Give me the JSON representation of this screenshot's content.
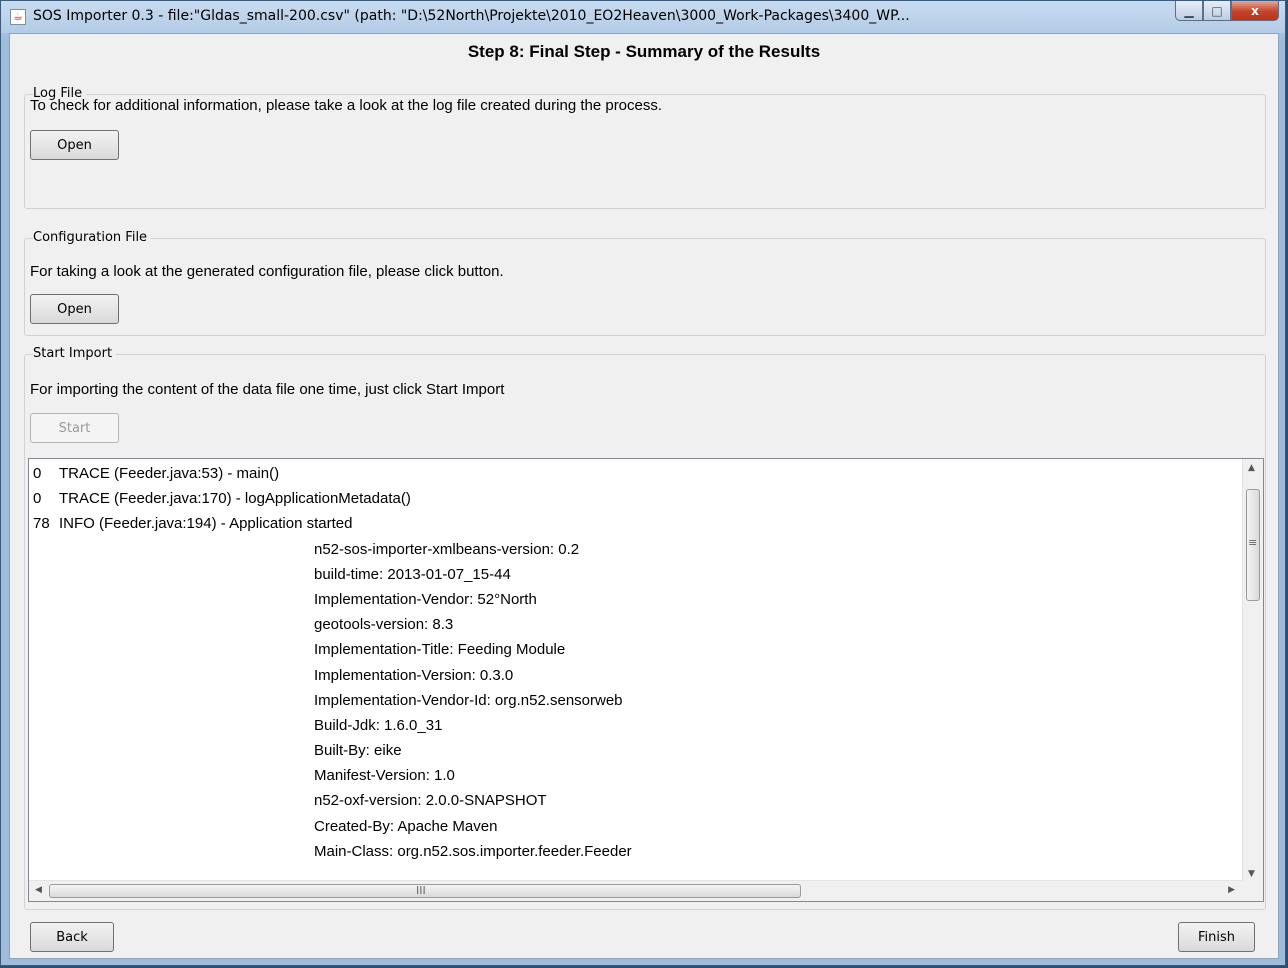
{
  "window": {
    "title": "SOS Importer 0.3 - file:\"Gldas_small-200.csv\" (path: \"D:\\52North\\Projekte\\2010_EO2Heaven\\3000_Work-Packages\\3400_WP...",
    "icon": "java-icon",
    "controls": {
      "minimize": "minimize-icon",
      "maximize": "maximize-icon",
      "close": "x"
    }
  },
  "step_title": "Step 8: Final Step - Summary of the Results",
  "log_file": {
    "label": "Log File",
    "description": "To check for additional information, please take a look at the log file created during the process.",
    "button": "Open"
  },
  "config_file": {
    "label": "Configuration File",
    "description": "For taking a look at the generated configuration file, please click button.",
    "button": "Open"
  },
  "start_import": {
    "label": "Start Import",
    "description": "For importing the content of the data file one time, just click Start Import",
    "button": "Start"
  },
  "log_lines": [
    {
      "time": "0",
      "text": "TRACE (Feeder.java:53) - main()"
    },
    {
      "time": "0",
      "text": "TRACE (Feeder.java:170) - logApplicationMetadata()"
    },
    {
      "time": "78",
      "text": " INFO (Feeder.java:194) - Application started"
    },
    {
      "time": "",
      "text": "n52-sos-importer-xmlbeans-version: 0.2"
    },
    {
      "time": "",
      "text": "build-time: 2013-01-07_15-44"
    },
    {
      "time": "",
      "text": "Implementation-Vendor: 52°North"
    },
    {
      "time": "",
      "text": "geotools-version: 8.3"
    },
    {
      "time": "",
      "text": "Implementation-Title: Feeding Module"
    },
    {
      "time": "",
      "text": "Implementation-Version: 0.3.0"
    },
    {
      "time": "",
      "text": "Implementation-Vendor-Id: org.n52.sensorweb"
    },
    {
      "time": "",
      "text": "Build-Jdk: 1.6.0_31"
    },
    {
      "time": "",
      "text": "Built-By: eike"
    },
    {
      "time": "",
      "text": "Manifest-Version: 1.0"
    },
    {
      "time": "",
      "text": "n52-oxf-version: 2.0.0-SNAPSHOT"
    },
    {
      "time": "",
      "text": "Created-By: Apache Maven"
    },
    {
      "time": "",
      "text": "Main-Class: org.n52.sos.importer.feeder.Feeder"
    }
  ],
  "scroll": {
    "up": "▲",
    "down": "▼",
    "left": "◀",
    "right": "▶",
    "vgrip": "≡",
    "hgrip": "III"
  },
  "nav": {
    "back": "Back",
    "finish": "Finish"
  }
}
